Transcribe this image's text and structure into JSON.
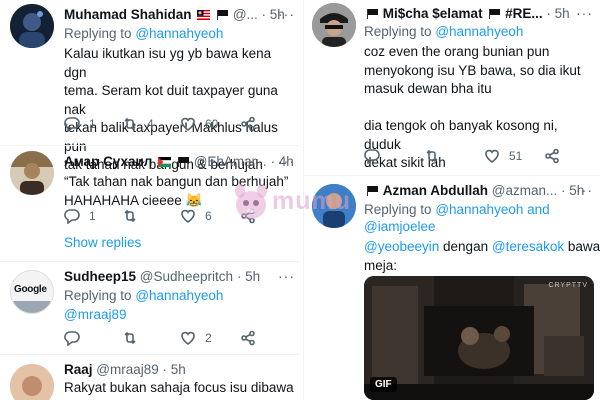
{
  "tweets_left": [
    {
      "name": "Muhamad Shahidan",
      "handle": "@...",
      "time": "5h",
      "replying_prefix": "Replying to",
      "replying_to": "@hannahyeoh",
      "lines": [
        "Kalau ikutkan isu yg yb bawa kena dgn",
        "tema. Seram kot duit taxpayer guna nak",
        "tekan balik taxpayer! Makhlus halus pun",
        "tak tahan nak bangun & berhujah"
      ],
      "reply_count": "1",
      "retweet_count": "4",
      "like_count": "60"
    },
    {
      "name": "Амар Сухаил",
      "handle": "@EhAmar...",
      "time": "4h",
      "lines": [
        "“Tak tahan nak bangun dan berhujah”",
        "HAHAHAHA cieeee 😹"
      ],
      "reply_count": "1",
      "retweet_count": "",
      "like_count": "6",
      "show_replies": "Show replies"
    },
    {
      "name": "Sudheep15",
      "handle": "@Sudheepritch",
      "time": "5h",
      "replying_prefix": "Replying to",
      "replying_to": "@hannahyeoh",
      "mention": "@mraaj89",
      "reply_count": "",
      "retweet_count": "",
      "like_count": "2",
      "avatar_text": "Google"
    },
    {
      "name": "Raaj",
      "handle": "@mraaj89",
      "time": "5h",
      "lines": [
        "Rakyat bukan sahaja focus isu dibawa"
      ]
    }
  ],
  "tweets_right": [
    {
      "name_prefix": "Mi$cha $elamat",
      "name_suffix": "#RE...",
      "time": "5h",
      "replying_prefix": "Replying to",
      "replying_to": "@hannahyeoh",
      "lines": [
        "coz even the orang bunian pun",
        "menyokong isu YB bawa, so dia ikut",
        "masuk dewan bha itu",
        "",
        "dia tengok oh banyak kosong ni, duduk",
        "dekat sikit lah"
      ],
      "reply_count": "",
      "retweet_count": "",
      "like_count": "51"
    },
    {
      "name": "Azman Abdullah",
      "handle": "@azman...",
      "time": "5h",
      "replying_prefix": "Replying to",
      "replying_to_a": "@hannahyeoh",
      "replying_and": "and",
      "replying_to_b": "@iamjoelee",
      "mention_a": "@yeobeeyin",
      "mention_mid": "dengan",
      "mention_b": "@teresakok",
      "mention_tail": "bawah",
      "line2": "meja:",
      "gif_label": "GIF",
      "gif_tag": "CRYPTTV"
    }
  ],
  "watermark": "mumu",
  "more_glyph": "···",
  "colors": {
    "link": "#1d9bf0",
    "muted": "#536471",
    "text": "#0f1419",
    "watermark": "#e3a6d2"
  }
}
